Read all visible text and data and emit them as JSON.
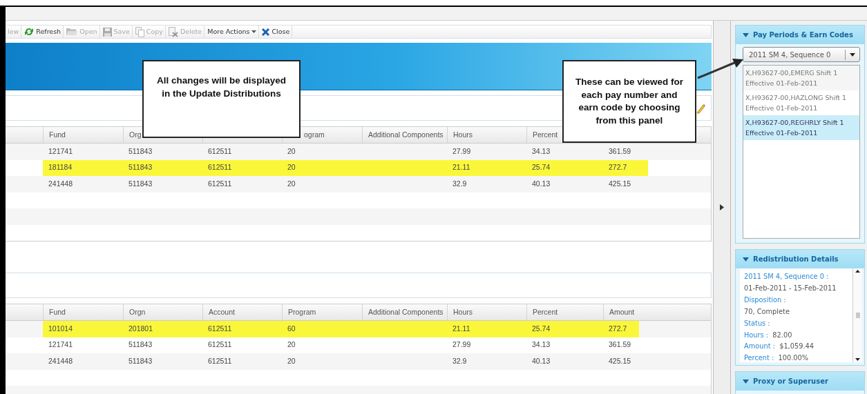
{
  "toolbar": [
    {
      "label": "lew",
      "kind": "new",
      "disabled": true
    },
    {
      "label": "Refresh",
      "kind": "refresh",
      "disabled": false
    },
    {
      "label": "Open",
      "kind": "open",
      "disabled": true
    },
    {
      "label": "Save",
      "kind": "save",
      "disabled": true
    },
    {
      "label": "Copy",
      "kind": "copy",
      "disabled": true
    },
    {
      "label": "Delete",
      "kind": "delete",
      "disabled": true
    },
    {
      "label": "More Actions",
      "kind": "menu",
      "disabled": false
    },
    {
      "label": "Close",
      "kind": "close",
      "disabled": false
    }
  ],
  "grids": [
    {
      "columns": [
        "Fund",
        "Org",
        "",
        "ogram",
        "Additional Components",
        "Hours",
        "Percent",
        ""
      ],
      "rows": [
        {
          "cells": [
            "121741",
            "511843",
            "612511",
            "20",
            "",
            "27.99",
            "34.13",
            "361.59"
          ],
          "highlighted": false
        },
        {
          "cells": [
            "181184",
            "511843",
            "612511",
            "20",
            "",
            "21.11",
            "25.74",
            "272.7"
          ],
          "highlighted": true
        },
        {
          "cells": [
            "241448",
            "511843",
            "612511",
            "20",
            "",
            "32.9",
            "40.13",
            "425.15"
          ],
          "highlighted": false
        }
      ]
    },
    {
      "columns": [
        "Fund",
        "Orgn",
        "Account",
        "Program",
        "Additional Components",
        "Hours",
        "Percent",
        "Amount"
      ],
      "rows": [
        {
          "cells": [
            "101014",
            "201801",
            "612511",
            "60",
            "",
            "21.11",
            "25.74",
            "272.7"
          ],
          "highlighted": true
        },
        {
          "cells": [
            "121741",
            "511843",
            "612511",
            "20",
            "",
            "27.99",
            "34.13",
            "361.59"
          ],
          "highlighted": false
        },
        {
          "cells": [
            "241448",
            "511843",
            "612511",
            "20",
            "",
            "32.9",
            "40.13",
            "425.15"
          ],
          "highlighted": false
        }
      ]
    }
  ],
  "side_panels": [
    {
      "title": "Pay Periods & Earn Codes",
      "expanded": true,
      "kind": "list",
      "combo": {
        "value": "2011 SM 4, Sequence 0"
      },
      "items": [
        {
          "line1": "X,H93627-00,EMERG Shift 1",
          "line2": "Effective 01-Feb-2011",
          "selected": false
        },
        {
          "line1": "X,H93627-00,HAZLONG Shift 1",
          "line2": "Effective 01-Feb-2011",
          "selected": false
        },
        {
          "line1": "X,H93627-00,REGHRLY Shift 1",
          "line2": "Effective 01-Feb-2011",
          "selected": true
        }
      ]
    },
    {
      "title": "Redistribution Details",
      "expanded": true,
      "kind": "details",
      "fields": [
        {
          "label": "2011 SM 4, Sequence 0 :",
          "value": "01-Feb-2011 - 15-Feb-2011",
          "kind": "stacked"
        },
        {
          "label": "Disposition :",
          "value": "70, Complete",
          "kind": "stacked"
        },
        {
          "label": "Status :",
          "kind": "stacked"
        },
        {
          "label": "Hours :",
          "value": "82.00",
          "kind": "inline"
        },
        {
          "label": "Amount :",
          "value": "$1,059.44",
          "kind": "inline"
        },
        {
          "label": "Percent :",
          "value": "100.00%",
          "kind": "inline"
        }
      ]
    },
    {
      "title": "Proxy or Superuser",
      "expanded": true,
      "kind": "empty"
    }
  ],
  "callouts": [
    {
      "text": "All changes will be displayed in the Update Distributions"
    },
    {
      "text": "These can be viewed for each pay number and earn code by choosing from this panel"
    }
  ]
}
